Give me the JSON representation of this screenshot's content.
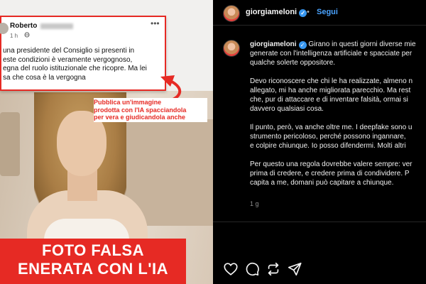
{
  "left_post": {
    "author": "Roberto",
    "time": "1 h",
    "visibility_icon": "globe-icon",
    "more_icon": "more-horizontal-icon",
    "text_lines": [
      "una presidente del Consiglio  si presenti in",
      "este condizioni è veramente vergognoso,",
      "egna del ruolo istituzionale che ricopre. Ma lei",
      "sa che cosa è la vergogna"
    ]
  },
  "annotation": {
    "lines": [
      "Pubblica un'immagine",
      "prodotta con l'IA spacciandola",
      "per vera e giudicandola anche"
    ]
  },
  "headline": {
    "line1": "FOTO FALSA",
    "line2": "ENERATA CON L'IA"
  },
  "instagram": {
    "username": "giorgiameloni",
    "verified_icon": "verified-badge-icon",
    "separator": "•",
    "follow_label": "Segui",
    "caption": {
      "p1": [
        "Girano in questi giorni diverse mie",
        "generate con l'intelligenza artificiale e spacciate per",
        "qualche solerte oppositore."
      ],
      "p2": [
        "Devo riconoscere che chi le ha realizzate, almeno n",
        "allegato, mi ha anche migliorata parecchio. Ma rest",
        "che, pur di attaccare e di inventare falsità, ormai si",
        "davvero qualsiasi cosa."
      ],
      "p3": [
        "Il punto, però, va anche oltre me. I deepfake sono u",
        "strumento pericoloso, perché possono ingannare,",
        "e colpire chiunque. Io posso difendermi. Molti altri"
      ],
      "p4": [
        "Per questo una regola dovrebbe valere sempre: ver",
        "prima di credere, e credere prima di condividere. P",
        "capita a me, domani può capitare a chiunque."
      ]
    },
    "timestamp": "1 g",
    "actions": [
      "heart-icon",
      "comment-icon",
      "repost-icon",
      "share-icon"
    ]
  },
  "colors": {
    "accent_red": "#e62a24",
    "instagram_blue": "#4aa3ff",
    "verified_blue": "#3897f0",
    "ig_background": "#000000"
  }
}
